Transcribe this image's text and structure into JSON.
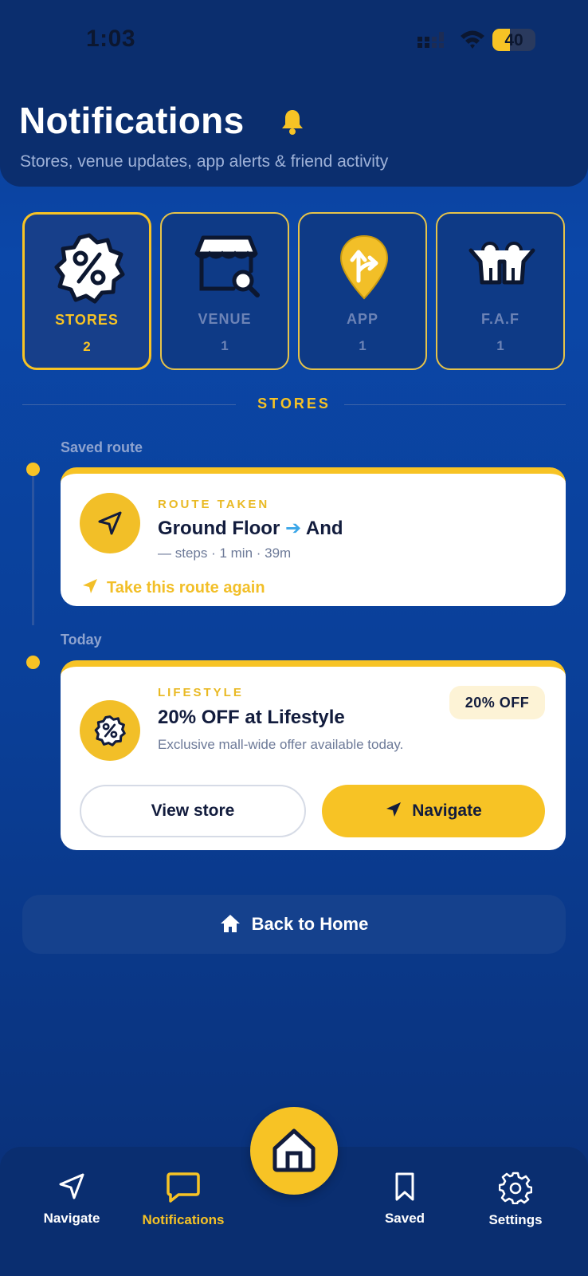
{
  "status_bar": {
    "time": "1:03",
    "battery": "40",
    "battery_level": 0.4
  },
  "header": {
    "title": "Notifications",
    "subtitle": "Stores, venue updates, app alerts & friend activity",
    "icon": "bell-icon"
  },
  "categories": [
    {
      "label": "STORES",
      "count": "2",
      "icon": "percent-badge-icon",
      "active": true
    },
    {
      "label": "VENUE",
      "count": "1",
      "icon": "storefront-search-icon",
      "active": false
    },
    {
      "label": "APP",
      "count": "1",
      "icon": "map-pin-directions-icon",
      "active": false
    },
    {
      "label": "F.A.F",
      "count": "1",
      "icon": "friends-icon",
      "active": false
    }
  ],
  "section_title": "STORES",
  "groups": [
    {
      "label": "Saved route",
      "card": {
        "eyebrow": "ROUTE TAKEN",
        "title_from": "Ground Floor",
        "title_arrow": "➔",
        "title_to": "And",
        "meta": "— steps · 1 min · 39m",
        "action": "Take this route again",
        "icon": "navigation-arrow-icon"
      }
    },
    {
      "label": "Today",
      "card": {
        "eyebrow": "LIFESTYLE",
        "title": "20% OFF at Lifestyle",
        "description": "Exclusive mall-wide offer available today.",
        "badge": "20% OFF",
        "secondary_button": "View store",
        "primary_button": "Navigate",
        "icon": "percent-badge-icon"
      }
    }
  ],
  "back_home": "Back to Home",
  "tabbar": {
    "items": [
      {
        "label": "Navigate",
        "icon": "navigation-arrow-icon",
        "active": false
      },
      {
        "label": "Notifications",
        "icon": "message-icon",
        "active": true
      },
      {
        "label": "Saved",
        "icon": "bookmark-icon",
        "active": false
      },
      {
        "label": "Settings",
        "icon": "gear-icon",
        "active": false
      }
    ],
    "center_icon": "home-icon"
  },
  "colors": {
    "accent": "#f7c325",
    "background": "#0b47a8",
    "header": "#0b2e6e",
    "card": "#ffffff",
    "text_dark": "#121c3d"
  }
}
